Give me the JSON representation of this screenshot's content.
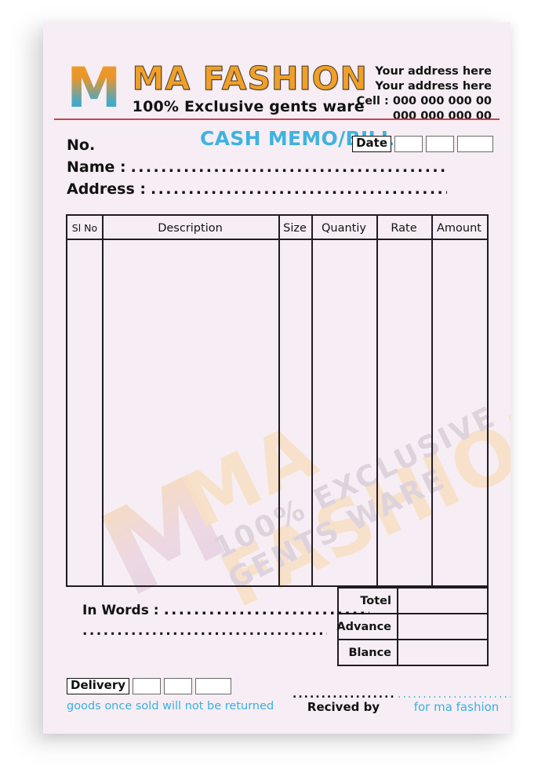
{
  "header": {
    "logo_letter": "M",
    "brand_name": "MA FASHION",
    "brand_tagline": "100% Exclusive gents ware",
    "address_line1": "Your address here",
    "address_line2": "Your address here",
    "cell_line1": "Cell : 000 000 000 00",
    "cell_line2": "000 000 000 00"
  },
  "meta": {
    "memo_title": "CASH MEMO/BILL",
    "date_label": "Date",
    "no_label": "No.",
    "name_label": "Name :",
    "address_label": "Address :",
    "dots_name": "............................................................",
    "dots_address": "........................................................",
    "date_boxes": [
      "",
      "",
      ""
    ]
  },
  "table": {
    "columns": [
      {
        "key": "sl_no",
        "label": "Sl No"
      },
      {
        "key": "description",
        "label": "Description"
      },
      {
        "key": "size",
        "label": "Size"
      },
      {
        "key": "quantity",
        "label": "Quantiy"
      },
      {
        "key": "rate",
        "label": "Rate"
      },
      {
        "key": "amount",
        "label": "Amount"
      }
    ],
    "rows": []
  },
  "totals": {
    "rows": [
      {
        "label": "Totel",
        "value": ""
      },
      {
        "label": "Advance",
        "value": ""
      },
      {
        "label": "Blance",
        "value": ""
      }
    ]
  },
  "in_words": {
    "label": "In Words :",
    "dots_line1": "..................................",
    "dots_line2": "..................................................."
  },
  "footer": {
    "delivery_label": "Delivery",
    "delivery_boxes": [
      "",
      "",
      ""
    ],
    "return_note": "goods once sold will not be returned",
    "received_by": "Recived by",
    "received_dots": "...........................",
    "for_company": "for ma fashion",
    "for_company_dots": "................................."
  },
  "watermark": {
    "letter": "M",
    "title": "MA FASHION",
    "subtitle": "100% EXCLUSIVE GENTS WARE"
  },
  "colors": {
    "paper": "#f6eef4",
    "accent_blue": "#3ab0de",
    "brand_orange": "#ef9f2a",
    "rule_red": "#c8424f",
    "footer_bar": "#1a69b5",
    "ink": "#221a22"
  }
}
